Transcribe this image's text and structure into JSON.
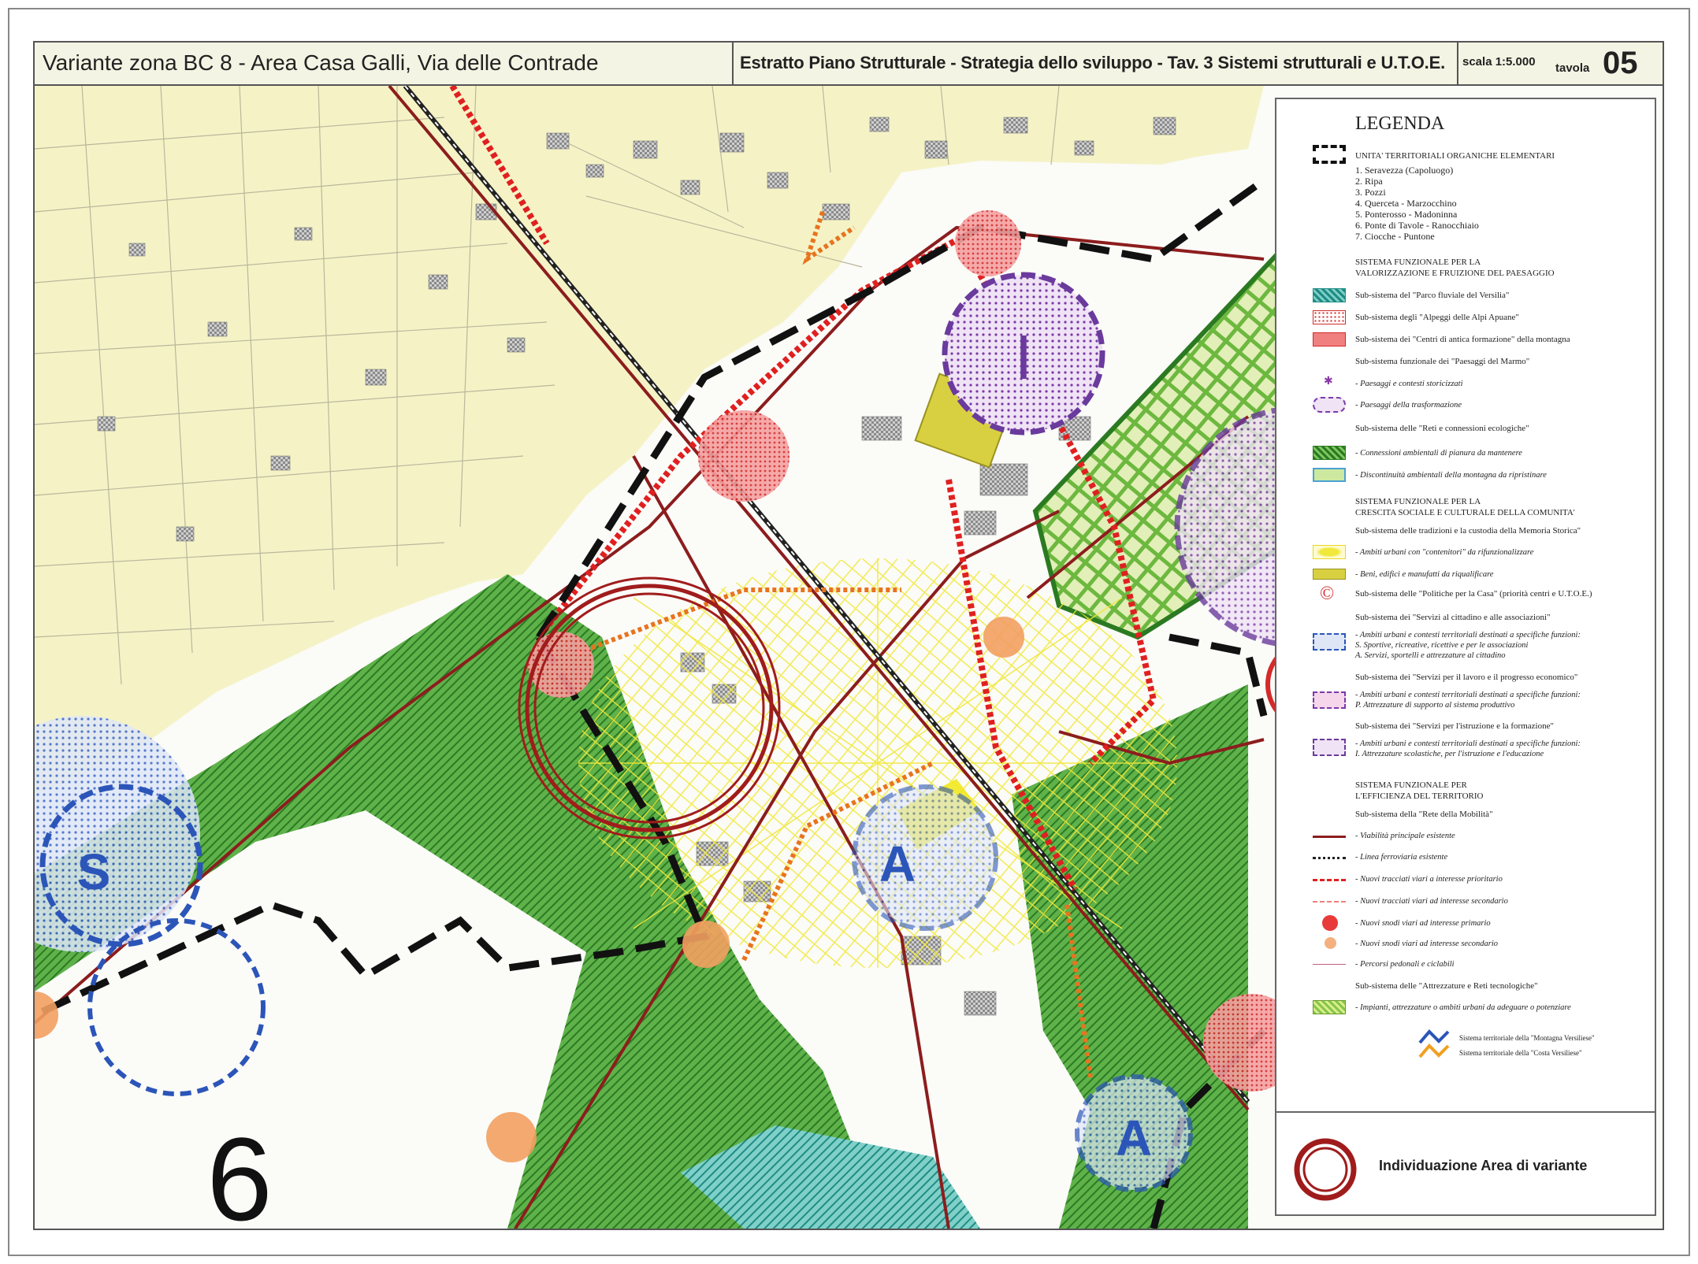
{
  "header": {
    "title": "Variante zona BC 8 - Area Casa Galli, Via delle Contrade",
    "subtitle": "Estratto Piano Strutturale - Strategia dello sviluppo - Tav. 3  Sistemi strutturali e U.T.O.E.",
    "scale": "scala 1:5.000",
    "tavola_label": "tavola",
    "tavola_number": "05"
  },
  "map_labels": {
    "utoe_number": "6",
    "symbol_i": "I",
    "symbol_a": "A",
    "symbol_s": "S"
  },
  "legend": {
    "title": "LEGENDA",
    "utoe_heading": "UNITA' TERRITORIALI ORGANICHE ELEMENTARI",
    "utoe_items": [
      "1. Seravezza (Capoluogo)",
      "2. Ripa",
      "3. Pozzi",
      "4. Querceta - Marzocchino",
      "5. Ponterosso - Madoninna",
      "6. Ponte di Tavole - Ranocchiaio",
      "7. Ciocche - Puntone"
    ],
    "sys1_heading_1": "SISTEMA FUNZIONALE PER LA",
    "sys1_heading_2": "VALORIZZAZIONE E FRUIZIONE DEL PAESAGGIO",
    "parco": "Sub-sistema del \"Parco fluviale del Versilia\"",
    "alpeggi": "Sub-sistema degli \"Alpeggi delle Alpi Apuane\"",
    "centri": "Sub-sistema dei \"Centri di antica formazione\" della montagna",
    "marmo": "Sub-sistema funzionale dei \"Paesaggi del Marmo\"",
    "storicizzati": "- Paesaggi e contesti storicizzati",
    "trasformazione": "- Paesaggi della trasformazione",
    "reti_eco": "Sub-sistema delle \"Reti e connessioni ecologiche\"",
    "connessioni": "- Connessioni ambientali di pianura da mantenere",
    "discontinuita": "- Discontinuità ambientali della montagna da ripristinare",
    "sys2_heading_1": "SISTEMA FUNZIONALE PER LA",
    "sys2_heading_2": "CRESCITA SOCIALE E CULTURALE DELLA COMUNITA'",
    "tradizioni": "Sub-sistema delle tradizioni e la custodia della Memoria Storica\"",
    "ambiti_contenitori": "- Ambiti urbani con \"contenitori\" da rifunzionalizzare",
    "beni": "- Beni, edifici e manufatti da riqualificare",
    "casa_symbol": "©",
    "casa": "Sub-sistema delle \"Politiche per la Casa\" (priorità centri e U.T.O.E.)",
    "servizi_cittadino": "Sub-sistema dei \"Servizi al cittadino e alle associazioni\"",
    "sc_1": "- Ambiti urbani e contesti territoriali destinati a specifiche funzioni:",
    "sc_2": "S. Sportive, ricreative, ricettive e per le associazioni",
    "sc_3": "A. Servizi, sportelli e attrezzature al cittadino",
    "servizi_lavoro": "Sub-sistema dei \"Servizi per il lavoro e il progresso economico\"",
    "sl_1": "- Ambiti urbani e contesti territoriali destinati a specifiche funzioni:",
    "sl_2": "P. Attrezzature di supporto al sistema produttivo",
    "servizi_istruzione": "Sub-sistema dei \"Servizi per  l'istruzione e la formazione\"",
    "si_1": "- Ambiti urbani e contesti territoriali destinati a specifiche funzioni:",
    "si_2": "I. Attrezzature scolastiche, per l'istruzione e l'educazione",
    "sys3_heading_1": "SISTEMA FUNZIONALE PER",
    "sys3_heading_2": "L'EFFICIENZA DEL TERRITORIO",
    "mobilita": "Sub-sistema della \"Rete della Mobilità\"",
    "viabilita": "- Viabilità principale esistente",
    "ferrovia": "- Linea ferroviaria esistente",
    "nuovi_prioritario": "- Nuovi tracciati viari a interesse prioritario",
    "nuovi_secondario": "- Nuovi tracciati viari ad interesse secondario",
    "snodi_primario": "- Nuovi snodi viari ad interesse primario",
    "snodi_secondario": "- Nuovi snodi viari ad interesse secondario",
    "percorsi": "- Percorsi pedonali e ciclabili",
    "attrezzature": "Sub-sistema delle \"Attrezzature e Reti tecnologiche\"",
    "impianti": "- Impianti, attrezzature o ambiti urbani da adeguare o potenziare",
    "montagna": "Sistema territoriale della \"Montagna Versiliese\"",
    "costa": "Sistema territoriale della \"Costa Versiliese\"",
    "variante_label": "Individuazione Area  di variante"
  },
  "colors": {
    "agricultural": "#f5f3c6",
    "green_corridor": "#3f9a32",
    "road": "#8c1d1d",
    "red_dotted": "#e02020",
    "orange_dotted": "#e8731f",
    "yellow_sunburst": "#f0e83a",
    "blue_service": "#2b55b8",
    "purple_school": "#6a3a9c",
    "teal_parco": "#2fa39a",
    "variant_ring": "#a01c1c"
  }
}
